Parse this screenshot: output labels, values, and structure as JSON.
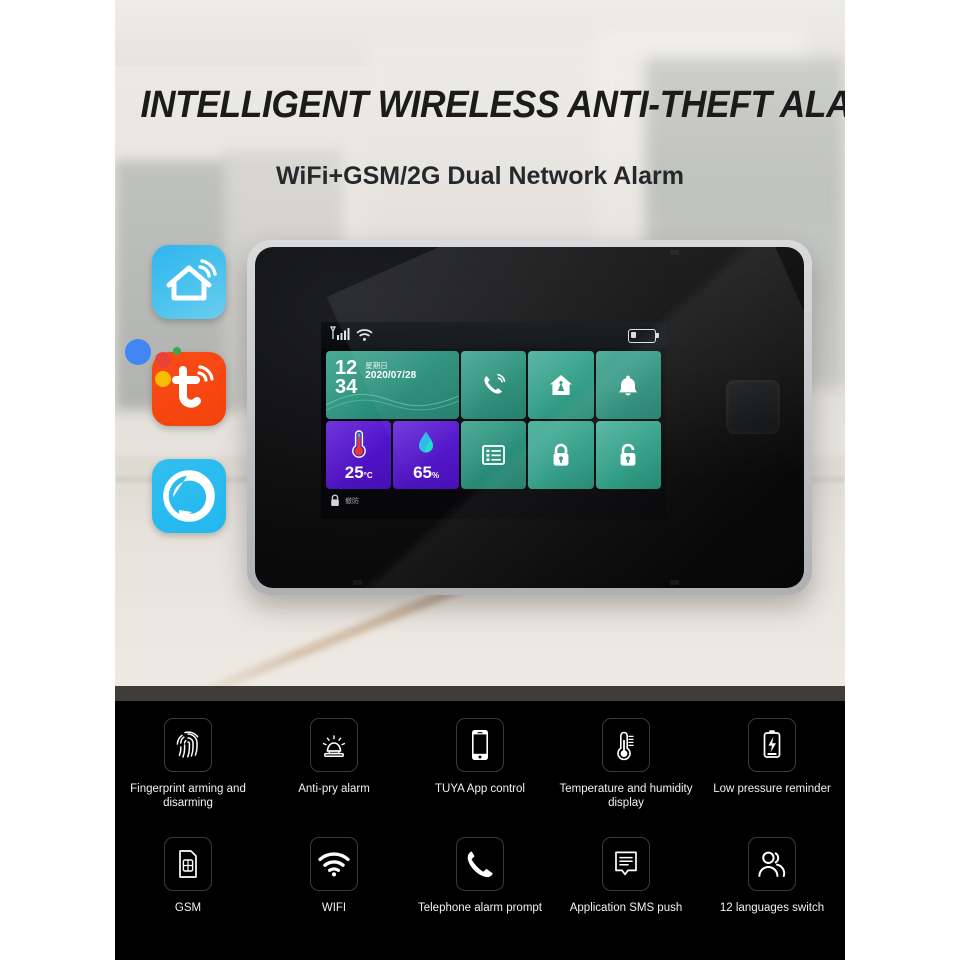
{
  "hero": {
    "headline": "INTELLIGENT WIRELESS ANTI-THEFT ALARM",
    "subheadline": "WiFi+GSM/2G Dual Network Alarm"
  },
  "app_badges": [
    {
      "name": "smart-life-app",
      "label": "Smart Life",
      "color": "#3cbcee",
      "icon": "home-wifi-icon"
    },
    {
      "name": "tuya-app",
      "label": "Tuya",
      "color": "#f4430d",
      "icon": "tuya-t-wifi-icon"
    },
    {
      "name": "amazon-alexa-app",
      "label": "Amazon Alexa",
      "color": "#26b9f0",
      "icon": "alexa-ring-icon"
    },
    {
      "name": "google-assistant",
      "label": "Google Assistant",
      "color": "#4285f4",
      "icon": "google-assistant-dots-icon"
    }
  ],
  "device": {
    "status_bar": {
      "signal_icon": "cellular-signal-icon",
      "wifi_icon": "wifi-icon",
      "battery_icon": "battery-low-icon",
      "battery_level": "low"
    },
    "clock_tile": {
      "hour": "12",
      "minute": "34",
      "weekday": "星期日",
      "date": "2020/07/28"
    },
    "sensor_tiles": [
      {
        "name": "temperature-tile",
        "icon": "thermometer-icon",
        "value": "25",
        "unit": "°C",
        "color": "#4f12c6"
      },
      {
        "name": "humidity-tile",
        "icon": "water-drop-icon",
        "value": "65",
        "unit": "%",
        "color": "#4f12c6"
      }
    ],
    "function_tiles": [
      {
        "name": "call-tile",
        "icon": "phone-ringing-icon"
      },
      {
        "name": "home-arm-tile",
        "icon": "house-icon"
      },
      {
        "name": "alarm-bell-tile",
        "icon": "bell-icon"
      },
      {
        "name": "menu-tile",
        "icon": "list-menu-icon"
      },
      {
        "name": "arm-tile",
        "icon": "lock-closed-icon"
      },
      {
        "name": "disarm-tile",
        "icon": "lock-open-icon"
      }
    ],
    "footer_status": {
      "icon": "lock-closed-icon",
      "text": "撤防"
    },
    "fingerprint_pad": "fingerprint-sensor-pad",
    "tile_color": "#27907a",
    "sensor_color": "#4f12c6"
  },
  "features": {
    "row1": [
      {
        "name": "feature-fingerprint",
        "icon": "fingerprint-icon",
        "label": "Fingerprint arming and disarming"
      },
      {
        "name": "feature-anti-pry",
        "icon": "siren-icon",
        "label": "Anti-pry alarm"
      },
      {
        "name": "feature-tuya-app",
        "icon": "smartphone-icon",
        "label": "TUYA App control"
      },
      {
        "name": "feature-temp-humidity",
        "icon": "thermometer-icon",
        "label": "Temperature and humidity display"
      },
      {
        "name": "feature-low-pressure",
        "icon": "battery-bolt-icon",
        "label": "Low pressure reminder"
      }
    ],
    "row2": [
      {
        "name": "feature-gsm",
        "icon": "sim-card-icon",
        "label": "GSM"
      },
      {
        "name": "feature-wifi",
        "icon": "wifi-icon",
        "label": "WIFI"
      },
      {
        "name": "feature-telephone",
        "icon": "phone-handset-icon",
        "label": "Telephone alarm prompt"
      },
      {
        "name": "feature-sms-push",
        "icon": "message-icon",
        "label": "Application SMS push"
      },
      {
        "name": "feature-languages",
        "icon": "people-icon",
        "label": "12 languages switch"
      }
    ]
  }
}
